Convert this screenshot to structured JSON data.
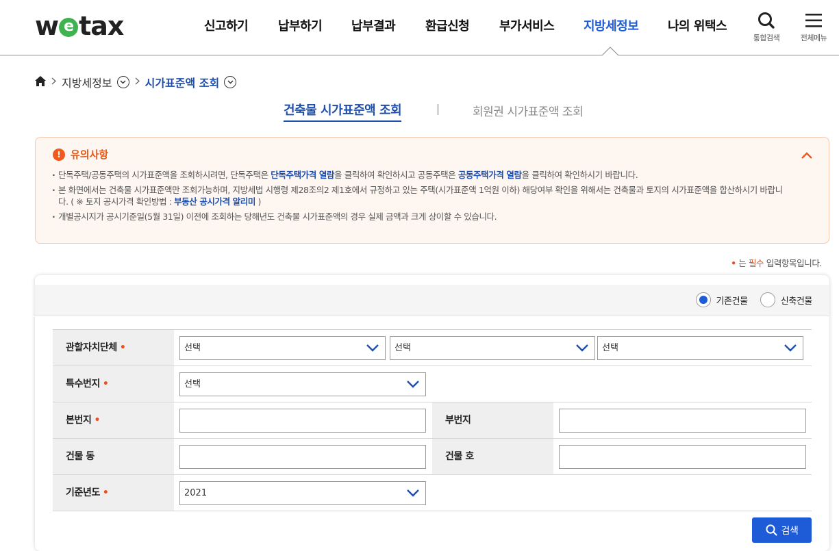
{
  "header": {
    "logo": {
      "pre": "w",
      "mid": "e",
      "post": "tax"
    },
    "menu": [
      {
        "label": "신고하기",
        "active": false
      },
      {
        "label": "납부하기",
        "active": false
      },
      {
        "label": "납부결과",
        "active": false
      },
      {
        "label": "환급신청",
        "active": false
      },
      {
        "label": "부가서비스",
        "active": false
      },
      {
        "label": "지방세정보",
        "active": true
      },
      {
        "label": "나의 위택스",
        "active": false
      }
    ],
    "search_label": "통합검색",
    "menu_label": "전체메뉴",
    "accent": "#1e5bd6"
  },
  "breadcrumb": {
    "level1": "지방세정보",
    "level2": "시가표준액 조회"
  },
  "tabs": [
    {
      "label": "건축물 시가표준액 조회",
      "active": true
    },
    {
      "label": "회원권 시가표준액 조회",
      "active": false
    }
  ],
  "notice": {
    "title": "유의사항",
    "items": [
      {
        "t1": "단독주택/공동주택의 시가표준액을 조회하시려면, 단독주택은 ",
        "link1": "단독주택가격 열람",
        "t2": "을 클릭하여 확인하시고 공동주택은 ",
        "link2": "공동주택가격 열람",
        "t3": "을 클릭하여 확인하시기 바랍니다."
      },
      {
        "t1": "본 화면에서는 건축물 시가표준액만 조회가능하며, 지방세법 시행령 제28조의2 제1호에서 규정하고 있는 주택(시가표준액 1억원 이하) 해당여부 확인을 위해서는 건축물과 토지의 시가표준액을 합산하시기 바랍니다. ( ※ 토지 공시가격 확인방법 : ",
        "link1": "부동산 공시가격 알리미",
        "t2": " )"
      },
      {
        "t1": "개별공시지가 공시기준일(5월 31일) 이전에 조회하는 당해년도 건축물 시가표준액의 경우 실제 금액과 크게 상이할 수 있습니다."
      }
    ]
  },
  "required_note": {
    "dot": "•",
    "pre": " 는 ",
    "req": "필수",
    "post": " 입력항목입니다."
  },
  "building_type": {
    "options": [
      {
        "label": "기존건물",
        "checked": true
      },
      {
        "label": "신축건물",
        "checked": false
      }
    ]
  },
  "form": {
    "jurisdiction": {
      "label": "관할자치단체",
      "selects": [
        "선택",
        "선택",
        "선택"
      ]
    },
    "special_lot": {
      "label": "특수번지",
      "select": "선택"
    },
    "main_lot": {
      "label": "본번지",
      "value": ""
    },
    "sub_lot": {
      "label": "부번지",
      "value": ""
    },
    "building_dong": {
      "label": "건물 동",
      "value": ""
    },
    "building_ho": {
      "label": "건물 호",
      "value": ""
    },
    "base_year": {
      "label": "기준년도",
      "select": "2021"
    },
    "must_mark": "•"
  },
  "search_button": "검색"
}
